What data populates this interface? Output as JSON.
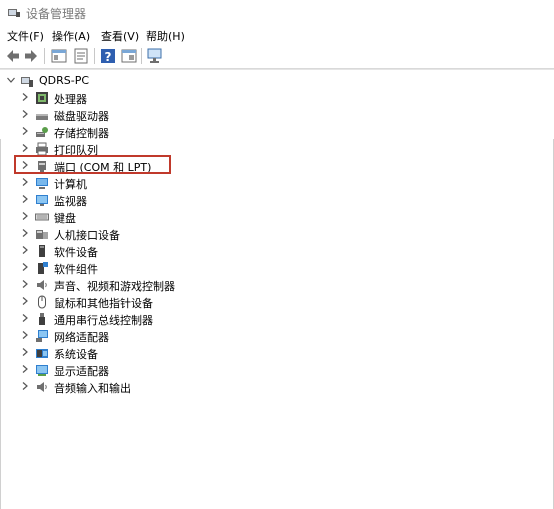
{
  "window": {
    "title": "设备管理器"
  },
  "menu": {
    "file": "文件(F)",
    "action": "操作(A)",
    "view": "查看(V)",
    "help": "帮助(H)"
  },
  "toolbar": {
    "buttons": [
      "back-icon",
      "forward-icon",
      "show-hide-tree-icon",
      "properties-icon",
      "help-icon",
      "update-driver-icon",
      "scan-hardware-icon"
    ]
  },
  "tree": {
    "root": "QDRS-PC",
    "children": [
      {
        "label": "处理器",
        "icon": "processor-icon"
      },
      {
        "label": "磁盘驱动器",
        "icon": "disk-drive-icon"
      },
      {
        "label": "存储控制器",
        "icon": "storage-controller-icon"
      },
      {
        "label": "打印队列",
        "icon": "print-queue-icon"
      },
      {
        "label": "端口 (COM 和 LPT)",
        "icon": "port-icon",
        "highlighted": true
      },
      {
        "label": "计算机",
        "icon": "computer-icon"
      },
      {
        "label": "监视器",
        "icon": "monitor-icon"
      },
      {
        "label": "键盘",
        "icon": "keyboard-icon"
      },
      {
        "label": "人机接口设备",
        "icon": "hid-icon"
      },
      {
        "label": "软件设备",
        "icon": "software-device-icon"
      },
      {
        "label": "软件组件",
        "icon": "software-component-icon"
      },
      {
        "label": "声音、视频和游戏控制器",
        "icon": "sound-icon"
      },
      {
        "label": "鼠标和其他指针设备",
        "icon": "mouse-icon"
      },
      {
        "label": "通用串行总线控制器",
        "icon": "usb-icon"
      },
      {
        "label": "网络适配器",
        "icon": "network-adapter-icon"
      },
      {
        "label": "系统设备",
        "icon": "system-device-icon"
      },
      {
        "label": "显示适配器",
        "icon": "display-adapter-icon"
      },
      {
        "label": "音频输入和输出",
        "icon": "audio-io-icon"
      }
    ]
  },
  "colors": {
    "highlight_border": "#c0392b",
    "title_text": "#7a7a7a"
  }
}
